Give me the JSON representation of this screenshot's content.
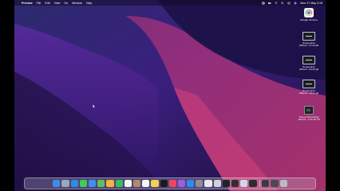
{
  "menubar": {
    "apple_glyph": "",
    "app_name": "Preview",
    "menus": [
      "File",
      "Edit",
      "View",
      "Go",
      "Window",
      "Help"
    ],
    "clock": "Mon 27 May 3:18"
  },
  "desktop": {
    "items": [
      {
        "type": "chrome",
        "icon": "google-chrome-icon",
        "label_lines": [
          "Google Chrome"
        ]
      },
      {
        "type": "screenshot",
        "icon": "screenshot-thumbnail-icon",
        "label_lines": [
          "Screenshot",
          "2024-0...17.44.48"
        ]
      },
      {
        "type": "screenshot",
        "icon": "screenshot-thumbnail-icon",
        "label_lines": [
          "Screenshot",
          "2024-0...24.34.gif"
        ]
      },
      {
        "type": "screenshot",
        "icon": "screenshot-thumbnail-icon",
        "label_lines": [
          "Screenshot",
          "2024-0...18.21.gif"
        ]
      },
      {
        "type": "recording",
        "icon": "screen-recording-thumbnail-icon",
        "label_lines": [
          "Screen Recording",
          "2024-0...1.01.26.78"
        ]
      }
    ]
  },
  "dock": {
    "apps": [
      {
        "name": "finder-icon",
        "color": "#3d8ee8"
      },
      {
        "name": "launchpad-icon",
        "color": "#9aa7bd"
      },
      {
        "name": "safari-icon",
        "color": "#2f8de4"
      },
      {
        "name": "messages-icon",
        "color": "#3fcd55"
      },
      {
        "name": "mail-icon",
        "color": "#3f8ef0"
      },
      {
        "name": "maps-icon",
        "color": "#5fc05a"
      },
      {
        "name": "photos-icon",
        "color": "#f2b340"
      },
      {
        "name": "facetime-icon",
        "color": "#36c058"
      },
      {
        "name": "calendar-icon",
        "color": "#f4f4f4"
      },
      {
        "name": "contacts-icon",
        "color": "#b08a62"
      },
      {
        "name": "reminders-icon",
        "color": "#f4f4f4"
      },
      {
        "name": "notes-icon",
        "color": "#f7d14c"
      },
      {
        "name": "tv-icon",
        "color": "#1b1b1e"
      },
      {
        "name": "music-icon",
        "color": "#f2455a"
      },
      {
        "name": "podcasts-icon",
        "color": "#a259e6"
      },
      {
        "name": "app-store-icon",
        "color": "#2b8cf0"
      },
      {
        "name": "system-settings-icon",
        "color": "#8d8d93"
      },
      {
        "name": "chrome-icon",
        "color": "#e8e8e8"
      },
      {
        "name": "iphone-mirroring-icon",
        "color": "#cfd2d8"
      },
      {
        "name": "terminal-icon",
        "color": "#222326"
      },
      {
        "name": "activity-monitor-icon",
        "color": "#2f3033"
      },
      {
        "name": "preview-icon",
        "color": "#cfd8e4"
      },
      {
        "name": "screenshot-app-icon",
        "color": "#2c2c30"
      }
    ],
    "stack": [
      {
        "name": "downloads-stack-icon",
        "color": "#3c3c40"
      },
      {
        "name": "recent-stack-icon",
        "color": "#4a4a50"
      },
      {
        "name": "trash-icon",
        "color": "#b9bcc4"
      }
    ]
  }
}
